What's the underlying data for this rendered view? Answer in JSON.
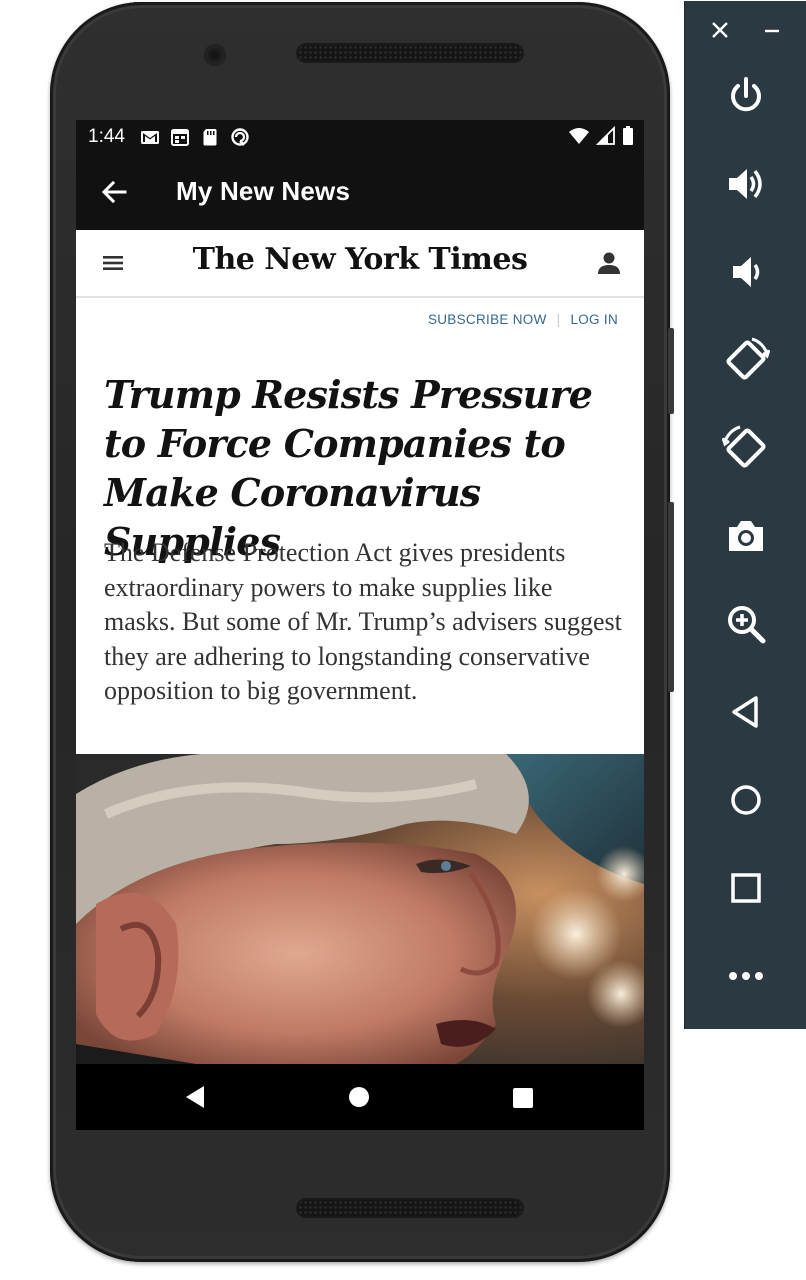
{
  "status_bar": {
    "time": "1:44",
    "left_icons": [
      "gmail-icon",
      "calendar-icon",
      "sd-card-icon",
      "sync-icon"
    ],
    "right_icons": [
      "wifi-icon",
      "signal-icon",
      "battery-icon"
    ]
  },
  "app_bar": {
    "title": "My New News",
    "back_icon": "arrow-back-icon"
  },
  "nyt": {
    "logo_text": "The New York Times",
    "subscribe_label": "SUBSCRIBE NOW",
    "separator": "|",
    "login_label": "LOG IN"
  },
  "article": {
    "headline": "Trump Resists Pressure to Force Companies to Make Coronavirus Supplies",
    "summary": "The Defense Protection Act gives presidents extraordinary powers to make supplies like masks. But some of Mr. Trump’s advisers suggest they are adhering to longstanding conservative opposition to big government."
  },
  "nav_bar": {
    "buttons": [
      "back-icon",
      "home-icon",
      "recents-icon"
    ]
  },
  "emulator_panel": {
    "window_controls": [
      "close-icon",
      "minimize-icon"
    ],
    "buttons": [
      "power-icon",
      "volume-up-icon",
      "volume-down-icon",
      "rotate-left-icon",
      "rotate-right-icon",
      "camera-icon",
      "zoom-icon",
      "back-icon",
      "home-icon",
      "overview-icon",
      "more-icon"
    ]
  },
  "colors": {
    "app_bar_bg": "#111111",
    "link_blue": "#326891",
    "panel_bg": "#2b3a42"
  }
}
